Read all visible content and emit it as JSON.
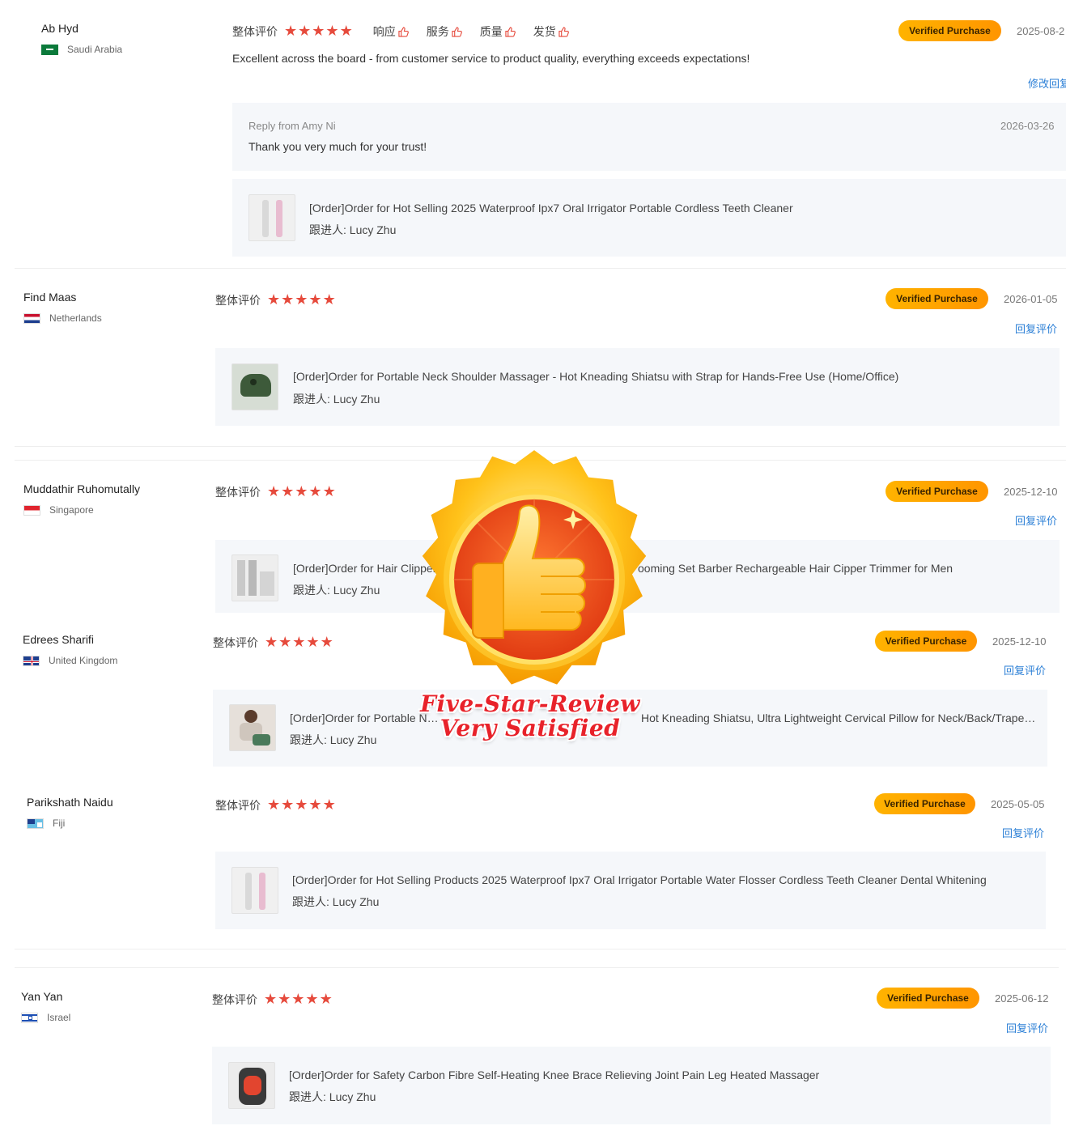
{
  "labels": {
    "overall": "整体评价",
    "verified": "Verified Purchase",
    "follow_prefix": "跟进人: "
  },
  "reviews": [
    {
      "name": "Ab Hyd",
      "country": "Saudi Arabia",
      "stars": 5,
      "date": "2025-08-2",
      "sub_ratings": [
        "响应",
        "服务",
        "质量",
        "发货"
      ],
      "comment": "Excellent across the board - from customer service to product quality, everything exceeds expectations!",
      "action": "修改回复",
      "reply": {
        "from": "Reply from Amy Ni",
        "date": "2026-03-26",
        "text": "Thank you very much for your trust!"
      },
      "order": {
        "title": "[Order]Order for Hot Selling 2025 Waterproof Ipx7 Oral Irrigator Portable Cordless Teeth Cleaner",
        "follow": "跟进人: Lucy Zhu"
      }
    },
    {
      "name": "Find Maas",
      "country": "Netherlands",
      "stars": 5,
      "date": "2026-01-05",
      "action": "回复评价",
      "order": {
        "title": "[Order]Order for Portable Neck Shoulder Massager - Hot Kneading Shiatsu with Strap for Hands-Free Use (Home/Office)",
        "follow": "跟进人: Lucy Zhu"
      }
    },
    {
      "name": "Muddathir Ruhomutally",
      "country": "Singapore",
      "stars": 5,
      "date": "2025-12-10",
      "action": "回复评价",
      "order": {
        "title": "[Order]Order for Hair Clipper",
        "title_tail": "ooming Set Barber Rechargeable Hair Cipper Trimmer for Men",
        "follow": "跟进人: Lucy Zhu"
      }
    },
    {
      "name": "Edrees Sharifi",
      "country": "United Kingdom",
      "stars": 5,
      "date": "2025-12-10",
      "action": "回复评价",
      "order": {
        "title": "[Order]Order for Portable Neck",
        "title_tail": "Hot Kneading Shiatsu, Ultra Lightweight Cervical Pillow for Neck/Back/Trapezi...",
        "follow": "跟进人: Lucy Zhu"
      }
    },
    {
      "name": "Parikshath Naidu",
      "country": "Fiji",
      "stars": 5,
      "date": "2025-05-05",
      "action": "回复评价",
      "order": {
        "title": "[Order]Order for Hot Selling Products 2025 Waterproof Ipx7 Oral Irrigator Portable Water Flosser Cordless Teeth Cleaner Dental Whitening",
        "follow": "跟进人: Lucy Zhu"
      }
    },
    {
      "name": "Yan Yan",
      "country": "Israel",
      "stars": 5,
      "date": "2025-06-12",
      "action": "回复评价",
      "order": {
        "title": "[Order]Order for Safety Carbon Fibre Self-Heating Knee Brace Relieving Joint Pain Leg Heated Massager",
        "follow": "跟进人: Lucy Zhu"
      }
    }
  ],
  "overlay": {
    "line1": "Five-Star-Review",
    "line2": "Very Satisfied"
  },
  "colors": {
    "star": "#e64a3c",
    "badge": "#ffa000",
    "link": "#2b7fd6",
    "panel": "#f5f7fa"
  }
}
